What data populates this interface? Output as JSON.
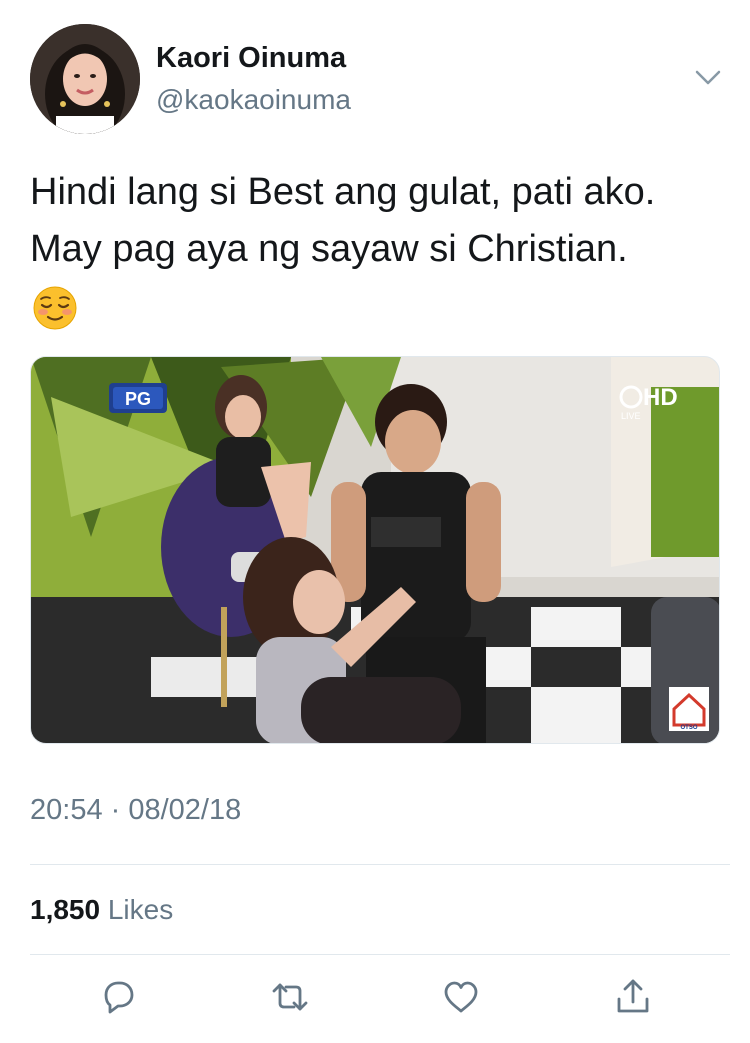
{
  "user": {
    "display_name": "Kaori Oinuma",
    "handle": "@kaokaoinuma"
  },
  "tweet": {
    "text": "Hindi lang si Best ang gulat, pati ako. May pag aya ng sayaw si Christian.",
    "emoji": "relieved-face"
  },
  "media": {
    "rating_badge": "PG",
    "channel_badge": "HD",
    "live_label": "LIVE",
    "show_badge": "OTSO"
  },
  "meta": {
    "timestamp": "20:54 · 08/02/18"
  },
  "stats": {
    "likes_count": "1,850",
    "likes_label": "Likes"
  },
  "actions": [
    "reply-icon",
    "retweet-icon",
    "like-icon",
    "share-icon"
  ],
  "colors": {
    "text": "#14171a",
    "secondary": "#657786",
    "divider": "#e1e8ed"
  }
}
